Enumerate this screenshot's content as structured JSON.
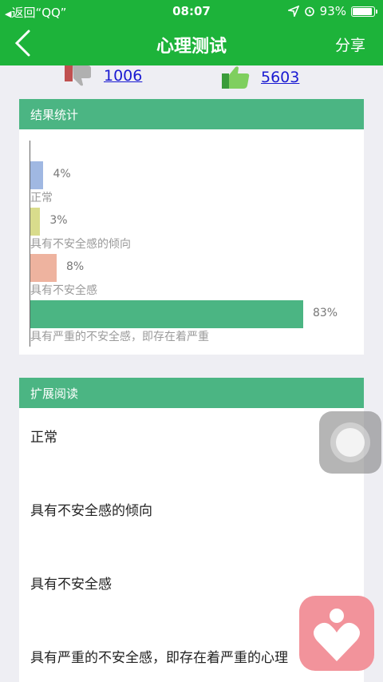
{
  "statusbar": {
    "back_label": "返回“QQ”",
    "time": "08:07",
    "battery": "93%",
    "battery_level": 0.93
  },
  "navbar": {
    "title": "心理测试",
    "share": "分享"
  },
  "votes": {
    "down_count": "1006",
    "up_count": "5603"
  },
  "results": {
    "header": "结果统计",
    "colors": [
      "#a0b8e2",
      "#d9dc8c",
      "#eeb39f",
      "#4bb583"
    ]
  },
  "chart_data": {
    "type": "bar",
    "orientation": "horizontal",
    "categories": [
      "正常",
      "具有不安全感的倾向",
      "具有不安全感",
      "具有严重的不安全感，即存在着严重"
    ],
    "values": [
      4,
      3,
      8,
      83
    ],
    "value_labels": [
      "4%",
      "3%",
      "8%",
      "83%"
    ],
    "xlim": [
      0,
      100
    ]
  },
  "reading": {
    "header": "扩展阅读",
    "items": [
      "正常",
      "具有不安全感的倾向",
      "具有不安全感",
      "具有严重的不安全感，即存在着严重的心理"
    ]
  }
}
